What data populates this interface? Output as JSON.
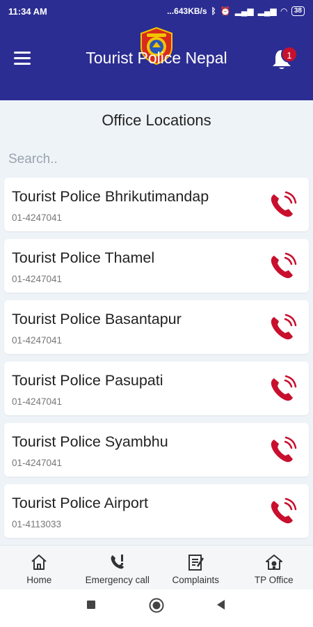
{
  "status": {
    "time": "11:34 AM",
    "network_speed": "...643KB/s",
    "battery": "38"
  },
  "header": {
    "title": "Tourist Police Nepal",
    "notification_count": "1"
  },
  "page": {
    "title": "Office Locations",
    "search_placeholder": "Search.."
  },
  "offices": [
    {
      "name": "Tourist Police Bhrikutimandap",
      "phone": "01-4247041"
    },
    {
      "name": "Tourist Police Thamel",
      "phone": "01-4247041"
    },
    {
      "name": "Tourist Police Basantapur",
      "phone": "01-4247041"
    },
    {
      "name": "Tourist Police Pasupati",
      "phone": "01-4247041"
    },
    {
      "name": "Tourist Police Syambhu",
      "phone": "01-4247041"
    },
    {
      "name": "Tourist Police Airport",
      "phone": "01-4113033"
    }
  ],
  "bottom_nav": [
    {
      "label": "Home",
      "icon": "home-icon"
    },
    {
      "label": "Emergency call",
      "icon": "emergency-call-icon"
    },
    {
      "label": "Complaints",
      "icon": "complaints-icon"
    },
    {
      "label": "TP Office",
      "icon": "tp-office-icon"
    }
  ],
  "colors": {
    "header_bg": "#2c2d92",
    "call_icon": "#c8102e",
    "badge": "#c8102e",
    "page_bg": "#eef3f8"
  }
}
